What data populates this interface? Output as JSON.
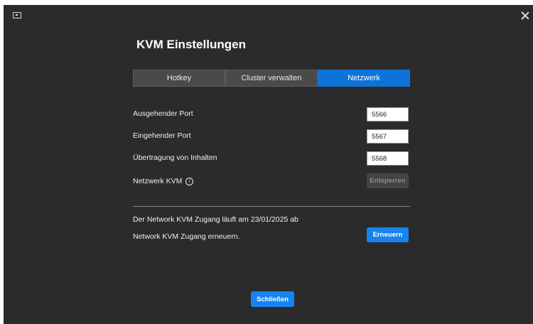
{
  "window": {
    "title": "KVM Einstellungen"
  },
  "tabs": [
    {
      "label": "Hotkey",
      "active": false
    },
    {
      "label": "Cluster verwalten",
      "active": false
    },
    {
      "label": "Netzwerk",
      "active": true
    }
  ],
  "ports": {
    "outgoing": {
      "label": "Ausgehender Port",
      "value": "5566"
    },
    "incoming": {
      "label": "Eingehender Port",
      "value": "5567"
    },
    "content": {
      "label": "Übertragung von Inhalten",
      "value": "5568"
    }
  },
  "network_kvm": {
    "label": "Netzwerk KVM",
    "info_icon": "i",
    "unlock_label": "Entsperren"
  },
  "access": {
    "expiry_text": "Der Network KVM Zugang läuft am 23/01/2025 ab",
    "renew_text": "Network KVM Zugang erneuern.",
    "renew_label": "Erneuern"
  },
  "footer": {
    "close_label": "Schließen"
  },
  "colors": {
    "background": "#2b2b2b",
    "accent": "#1683f2",
    "tab_active": "#0d73d9",
    "tab_inactive": "#4a4a4a"
  },
  "icons": {
    "app": "monitor-icon",
    "close": "close-icon",
    "info": "info-icon"
  }
}
